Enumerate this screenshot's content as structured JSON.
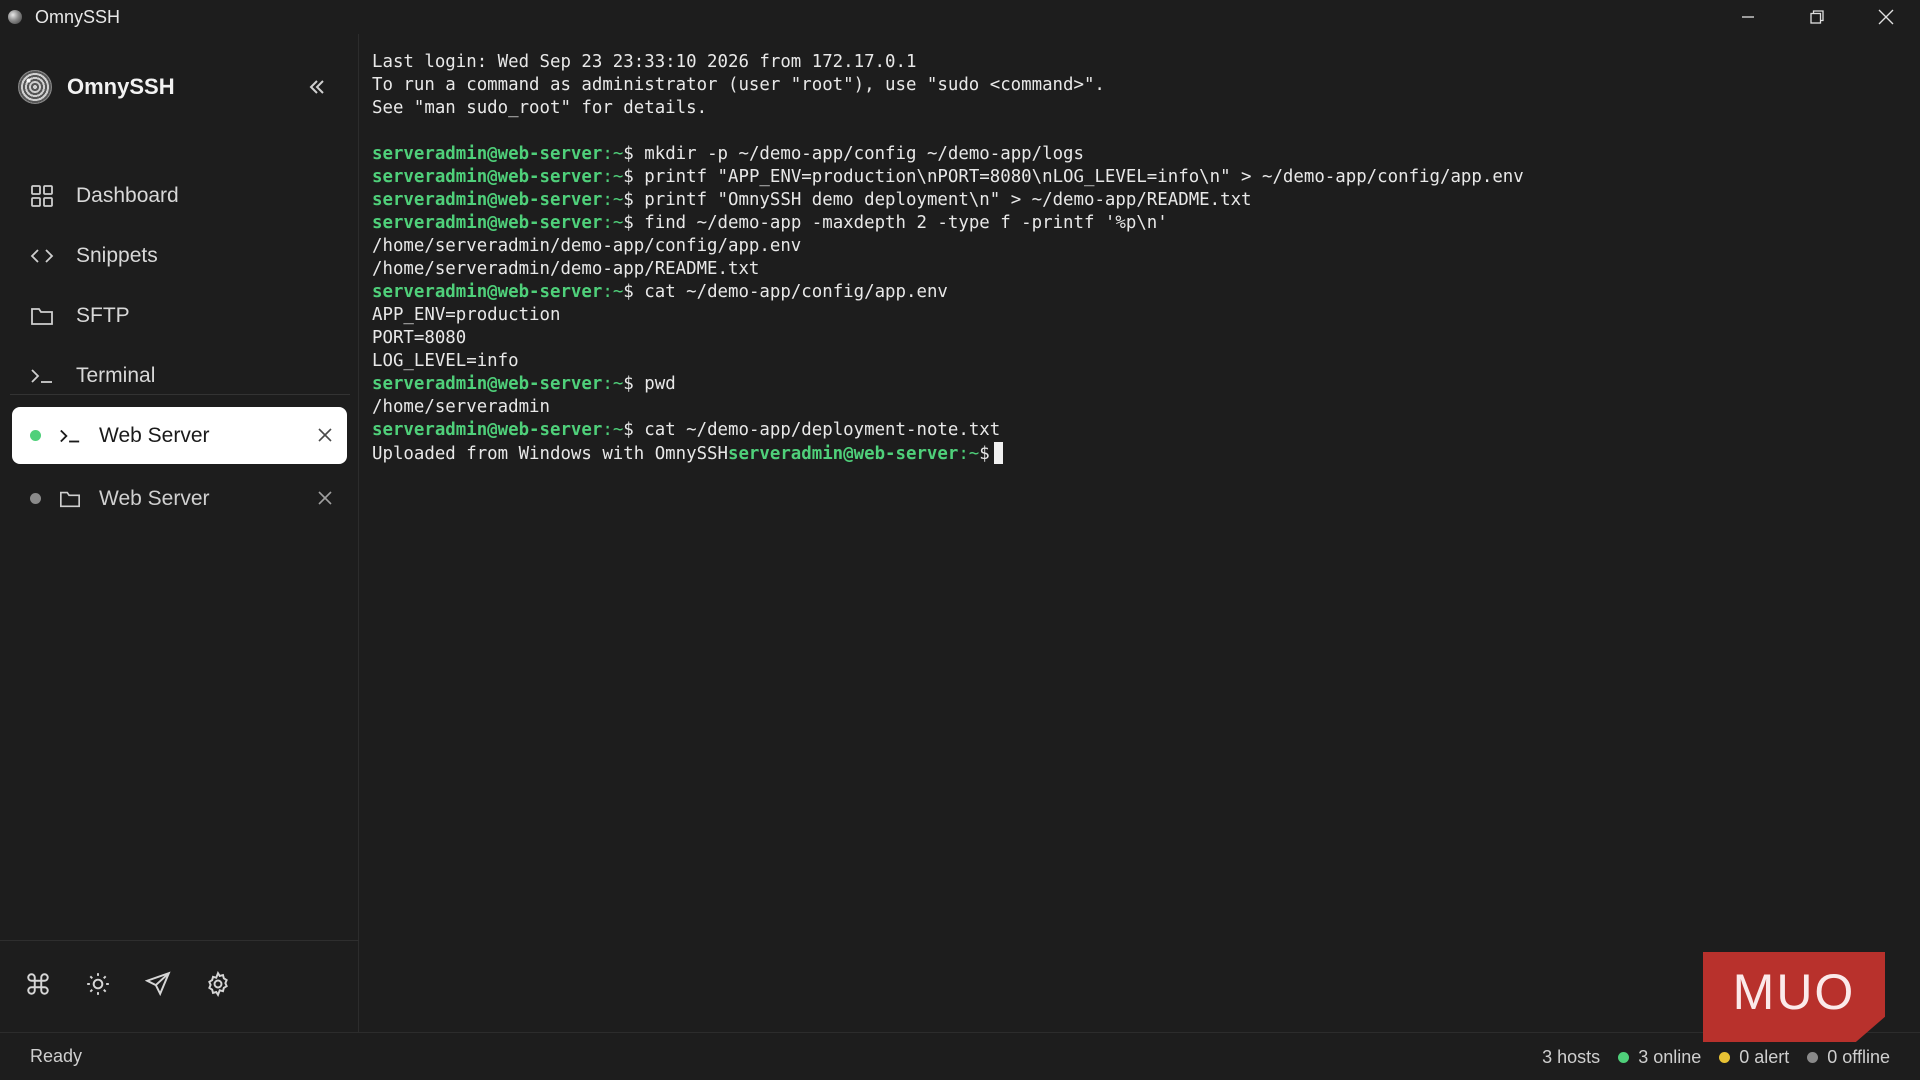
{
  "window": {
    "title": "OmnySSH"
  },
  "sidebar": {
    "brand": "OmnySSH",
    "nav": [
      {
        "label": "Dashboard",
        "icon": "grid-icon"
      },
      {
        "label": "Snippets",
        "icon": "code-icon"
      },
      {
        "label": "SFTP",
        "icon": "folder-icon"
      },
      {
        "label": "Terminal",
        "icon": "terminal-icon"
      }
    ],
    "sessions": [
      {
        "label": "Web Server",
        "type": "terminal",
        "status_color": "#4fd07a",
        "active": true
      },
      {
        "label": "Web Server",
        "type": "sftp",
        "status_color": "#8a8a8a",
        "active": false
      }
    ],
    "tools": [
      "command-icon",
      "sun-icon",
      "send-icon",
      "gear-icon"
    ]
  },
  "terminal": {
    "lines": [
      {
        "text": "Last login: Wed Sep 23 23:33:10 2026 from 172.17.0.1"
      },
      {
        "text": "To run a command as administrator (user \"root\"), use \"sudo <command>\"."
      },
      {
        "text": "See \"man sudo_root\" for details."
      },
      {
        "text": ""
      },
      {
        "prompt": "serveradmin@web-server",
        "text": "mkdir -p ~/demo-app/config ~/demo-app/logs"
      },
      {
        "prompt": "serveradmin@web-server",
        "text": "printf \"APP_ENV=production\\nPORT=8080\\nLOG_LEVEL=info\\n\" > ~/demo-app/config/app.env"
      },
      {
        "prompt": "serveradmin@web-server",
        "text": "printf \"OmnySSH demo deployment\\n\" > ~/demo-app/README.txt"
      },
      {
        "prompt": "serveradmin@web-server",
        "text": "find ~/demo-app -maxdepth 2 -type f -printf '%p\\n'"
      },
      {
        "text": "/home/serveradmin/demo-app/config/app.env"
      },
      {
        "text": "/home/serveradmin/demo-app/README.txt"
      },
      {
        "prompt": "serveradmin@web-server",
        "text": "cat ~/demo-app/config/app.env"
      },
      {
        "text": "APP_ENV=production"
      },
      {
        "text": "PORT=8080"
      },
      {
        "text": "LOG_LEVEL=info"
      },
      {
        "prompt": "serveradmin@web-server",
        "text": "pwd"
      },
      {
        "text": "/home/serveradmin"
      },
      {
        "prompt": "serveradmin@web-server",
        "text": "cat ~/demo-app/deployment-note.txt"
      },
      {
        "text": "Uploaded from Windows with OmnySSH",
        "trailing_prompt": "serveradmin@web-server",
        "cursor": true
      }
    ],
    "prompt_suffix": ":~$ ",
    "prompt_color": "#4fd07a"
  },
  "status": {
    "left": "Ready",
    "hosts": "3 hosts",
    "online": "3 online",
    "alert": "0 alert",
    "offline": "0 offline",
    "online_color": "#4fd07a",
    "alert_color": "#e8c234",
    "offline_color": "#8a8a8a"
  },
  "watermark": "MUO"
}
